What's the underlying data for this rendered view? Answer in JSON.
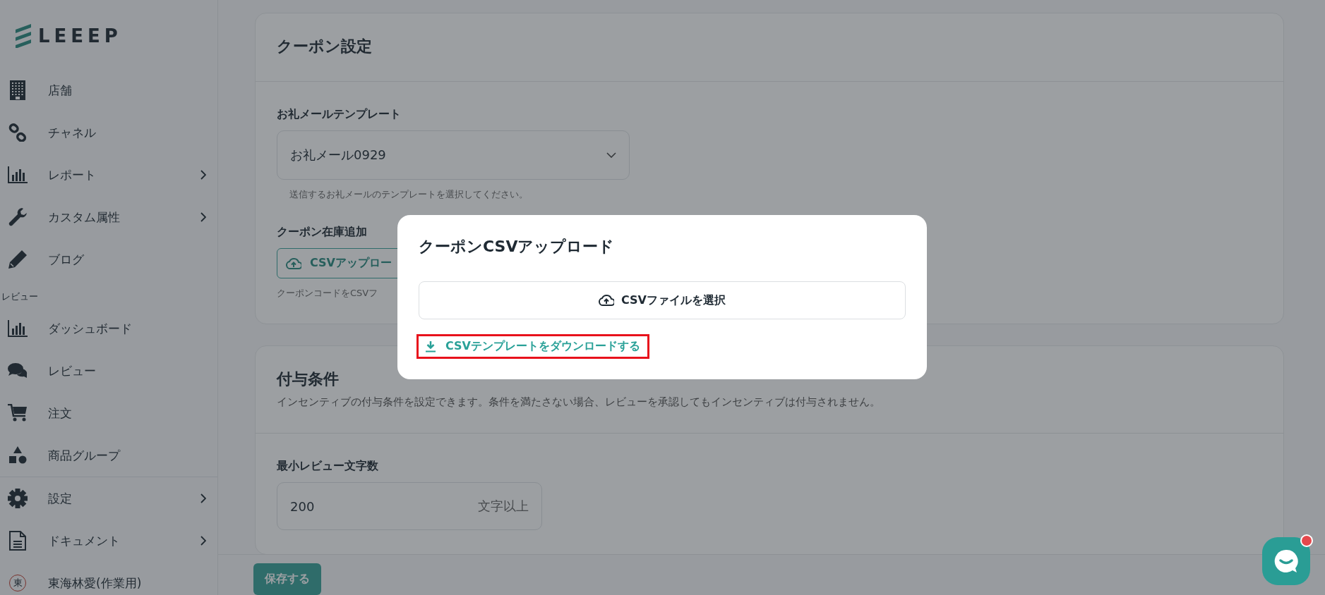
{
  "sidebar": {
    "logo": "LEEEP",
    "items": [
      {
        "kind": "link",
        "label": "店舗",
        "expandable": false
      },
      {
        "kind": "link",
        "label": "チャネル",
        "expandable": false
      },
      {
        "kind": "link",
        "label": "レポート",
        "expandable": true
      },
      {
        "kind": "link",
        "label": "カスタム属性",
        "expandable": true
      },
      {
        "kind": "link",
        "label": "ブログ",
        "expandable": false
      },
      {
        "kind": "heading",
        "label": "レビュー"
      },
      {
        "kind": "link",
        "label": "ダッシュボード",
        "expandable": false
      },
      {
        "kind": "link",
        "label": "レビュー",
        "expandable": false
      },
      {
        "kind": "link",
        "label": "注文",
        "expandable": false
      },
      {
        "kind": "link",
        "label": "商品グループ",
        "expandable": false
      },
      {
        "kind": "divider"
      },
      {
        "kind": "link",
        "label": "設定",
        "expandable": true
      },
      {
        "kind": "link",
        "label": "ドキュメント",
        "expandable": true
      },
      {
        "kind": "user",
        "label": "東海林愛(作業用)",
        "initial": "東"
      }
    ]
  },
  "coupon_card": {
    "title": "クーポン設定",
    "fields": [
      {
        "kind": "select",
        "label": "お礼メールテンプレート",
        "value": "お礼メール0929",
        "help": "送信するお礼メールのテンプレートを選択してください。"
      },
      {
        "kind": "upload",
        "label": "クーポン在庫追加",
        "button": "CSVアップロー",
        "help": "クーポンコードをCSVフ"
      }
    ]
  },
  "incentive_card": {
    "title": "付与条件",
    "description": "インセンティブの付与条件を設定できます。条件を満たさない場合、レビューを承認してもインセンティブは付与されません。",
    "fields": [
      {
        "kind": "number",
        "label": "最小レビュー文字数",
        "value": "200",
        "suffix": "文字以上"
      }
    ]
  },
  "save_button": "保存する",
  "modal": {
    "title": "クーポンCSVアップロード",
    "select_button": "CSVファイルを選択",
    "download_link": "CSVテンプレートをダウンロードする",
    "highlighted": true
  },
  "chat_button": {
    "unread": true
  }
}
